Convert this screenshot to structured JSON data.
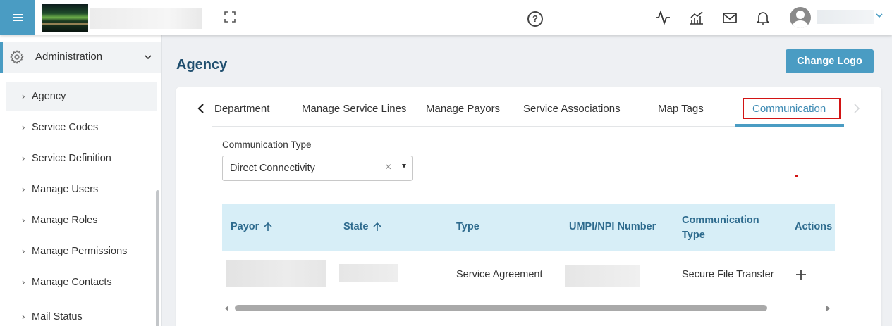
{
  "header": {
    "help_symbol": "?"
  },
  "sidebar": {
    "section_label": "Administration",
    "items": [
      {
        "label": "Agency"
      },
      {
        "label": "Service Codes"
      },
      {
        "label": "Service Definition"
      },
      {
        "label": "Manage Users"
      },
      {
        "label": "Manage Roles"
      },
      {
        "label": "Manage Permissions"
      },
      {
        "label": "Manage Contacts"
      },
      {
        "label": "Mail Status"
      }
    ]
  },
  "main": {
    "page_title": "Agency",
    "change_logo_label": "Change Logo",
    "tabs": [
      {
        "label": "Department"
      },
      {
        "label": "Manage Service Lines"
      },
      {
        "label": "Manage Payors"
      },
      {
        "label": "Service Associations"
      },
      {
        "label": "Map Tags"
      },
      {
        "label": "Communication"
      }
    ],
    "active_tab": "Communication",
    "communication_type": {
      "label": "Communication Type",
      "value": "Direct Connectivity",
      "clear_symbol": "×"
    },
    "table": {
      "columns": [
        "Payor",
        "State",
        "Type",
        "UMPI/NPI Number",
        "Communication Type",
        "Actions"
      ],
      "rows": [
        {
          "type": "Service Agreement",
          "communication_type": "Secure File Transfer"
        }
      ]
    }
  },
  "colors": {
    "accent": "#4a9cc3",
    "title": "#1f4e6e",
    "table_header_bg": "#d7eef7",
    "highlight_border": "#d21414"
  }
}
